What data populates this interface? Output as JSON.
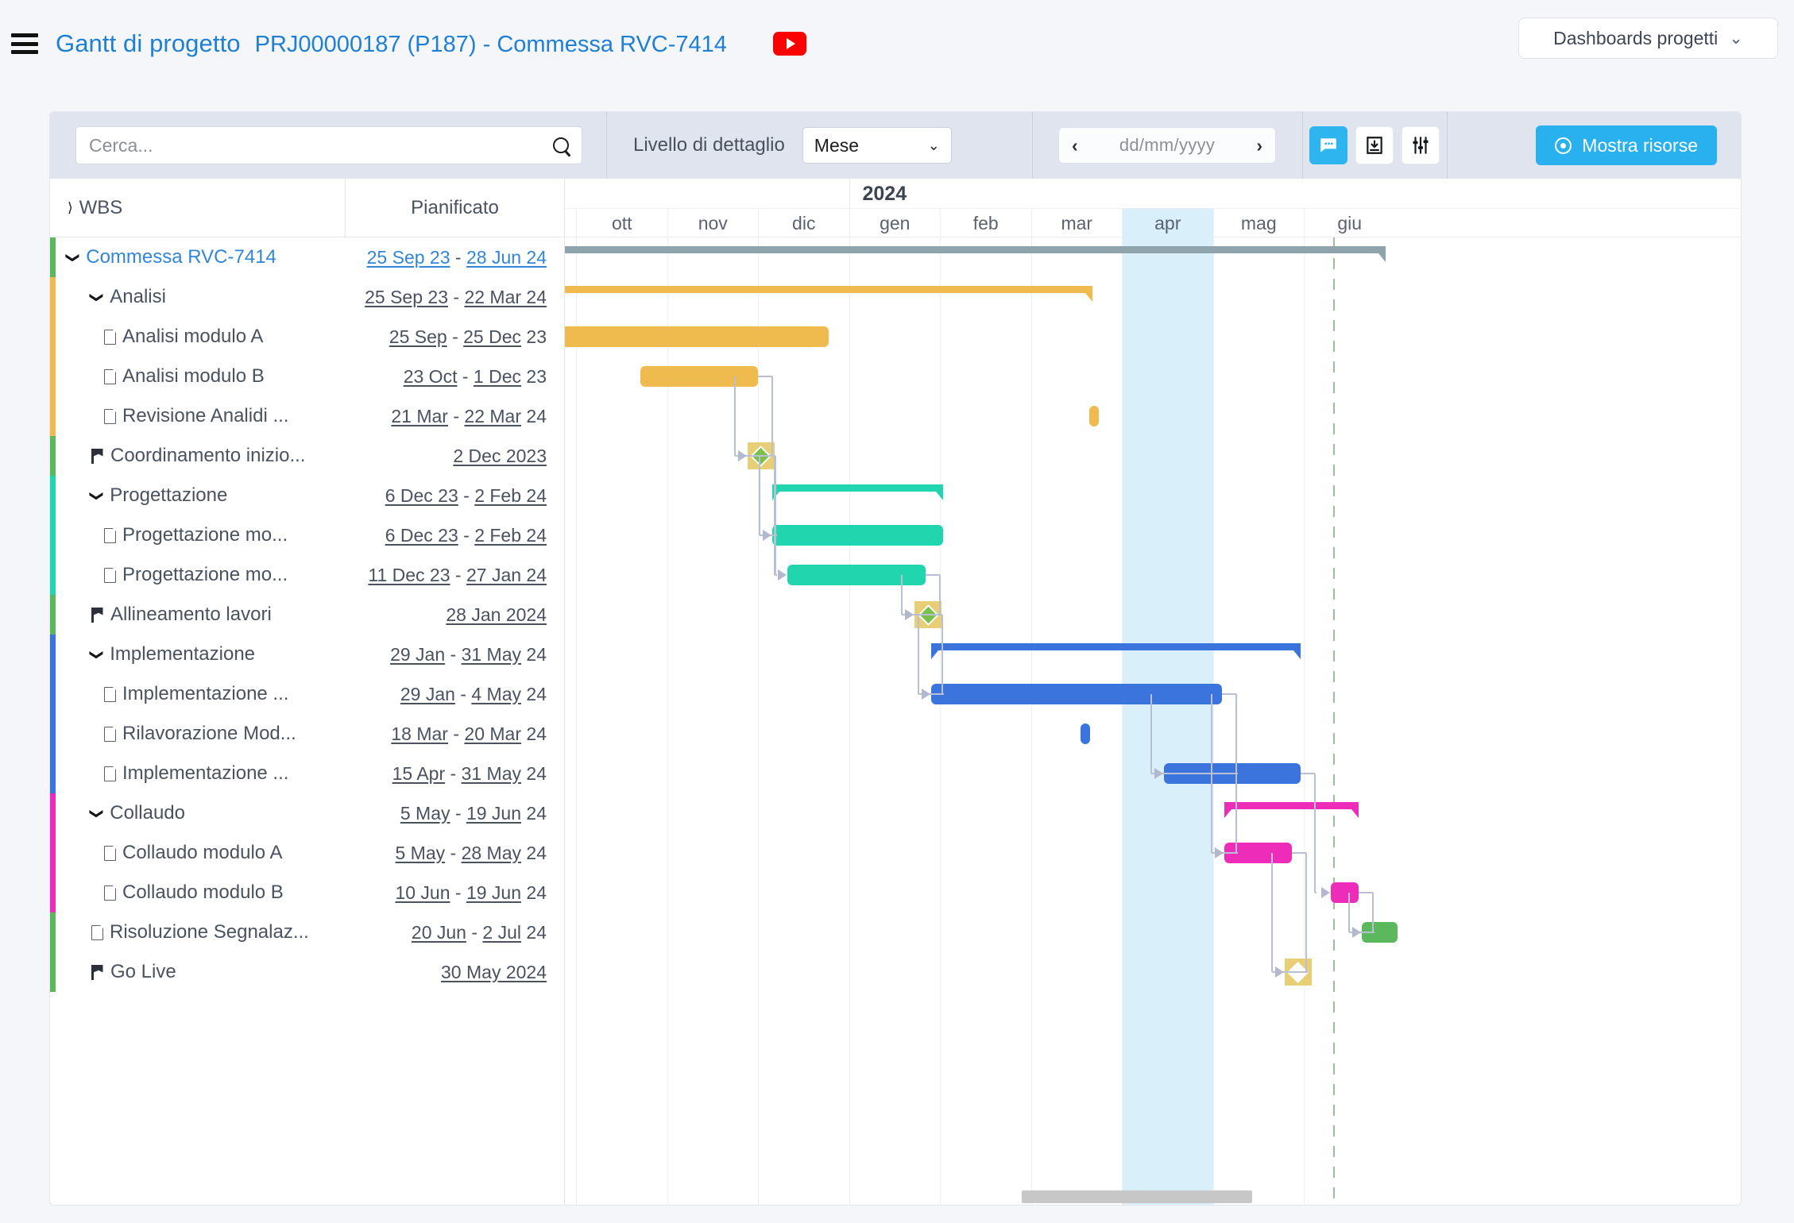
{
  "header": {
    "menu_icon": "hamburger-icon",
    "title": "Gantt di progetto",
    "subtitle": "PRJ00000187 (P187) - Commessa RVC-7414",
    "video_icon": "youtube-play-icon",
    "dashboard_select": {
      "label": "Dashboards progetti",
      "chevron": "⌄"
    }
  },
  "toolbar": {
    "search_placeholder": "Cerca...",
    "search_value": "",
    "search_icon": "search-icon",
    "detail_label": "Livello di dettaglio",
    "detail_value": "Mese",
    "detail_chevron": "⌄",
    "date_prev": "‹",
    "date_next": "›",
    "date_value": "dd/mm/yyyy",
    "icons": [
      "comment-icon",
      "export-icon",
      "settings-sliders-icon"
    ],
    "resources_button": "Mostra risorse",
    "accent_blue": "#29b1ef"
  },
  "grid": {
    "col_wbs": "WBS",
    "col_planned": "Pianificato",
    "rows": [
      {
        "name": "Commessa RVC-7414",
        "level": 0,
        "icon": "caret-down-icon",
        "kind": "root",
        "start": "25 Sep 23",
        "end": "28 Jun 24",
        "year_suffix": "",
        "stripe": "#5cb85c"
      },
      {
        "name": "Analisi",
        "level": 1,
        "icon": "caret-down-icon",
        "kind": "summary",
        "start": "25 Sep 23",
        "end": "22 Mar 24",
        "year_suffix": "",
        "stripe": "#efbb4e"
      },
      {
        "name": "Analisi modulo A",
        "level": 2,
        "icon": "doc-icon",
        "kind": "task",
        "start": "25 Sep",
        "end": "25 Dec",
        "year_suffix": " 23",
        "stripe": "#efbb4e"
      },
      {
        "name": "Analisi modulo B",
        "level": 2,
        "icon": "doc-icon",
        "kind": "task",
        "start": "23 Oct",
        "end": "1 Dec",
        "year_suffix": " 23",
        "stripe": "#efbb4e"
      },
      {
        "name": "Revisione Analidi ...",
        "level": 2,
        "icon": "doc-icon",
        "kind": "task",
        "start": "21 Mar",
        "end": "22 Mar",
        "year_suffix": " 24",
        "stripe": "#efbb4e"
      },
      {
        "name": "Coordinamento inizio...",
        "level": 1,
        "icon": "flag-icon",
        "kind": "milestone",
        "start": "",
        "end": "2 Dec 2023",
        "year_suffix": "",
        "stripe": "#5cb85c"
      },
      {
        "name": "Progettazione",
        "level": 1,
        "icon": "caret-down-icon",
        "kind": "summary",
        "start": "6 Dec 23",
        "end": "2 Feb 24",
        "year_suffix": "",
        "stripe": "#21d6ae"
      },
      {
        "name": "Progettazione mo...",
        "level": 2,
        "icon": "doc-icon",
        "kind": "task",
        "start": "6 Dec 23",
        "end": "2 Feb 24",
        "year_suffix": "",
        "stripe": "#21d6ae"
      },
      {
        "name": "Progettazione mo...",
        "level": 2,
        "icon": "doc-icon",
        "kind": "task",
        "start": "11 Dec 23",
        "end": "27 Jan 24",
        "year_suffix": "",
        "stripe": "#21d6ae"
      },
      {
        "name": "Allineamento lavori",
        "level": 1,
        "icon": "flag-icon",
        "kind": "milestone",
        "start": "",
        "end": "28 Jan 2024",
        "year_suffix": "",
        "stripe": "#5cb85c"
      },
      {
        "name": "Implementazione",
        "level": 1,
        "icon": "caret-down-icon",
        "kind": "summary",
        "start": "29 Jan",
        "end": "31 May",
        "year_suffix": " 24",
        "stripe": "#3b74dd"
      },
      {
        "name": "Implementazione ...",
        "level": 2,
        "icon": "doc-icon",
        "kind": "task",
        "start": "29 Jan",
        "end": "4 May",
        "year_suffix": " 24",
        "stripe": "#3b74dd"
      },
      {
        "name": "Rilavorazione Mod...",
        "level": 2,
        "icon": "doc-icon",
        "kind": "task",
        "start": "18 Mar",
        "end": "20 Mar",
        "year_suffix": " 24",
        "stripe": "#3b74dd"
      },
      {
        "name": "Implementazione ...",
        "level": 2,
        "icon": "doc-icon",
        "kind": "task",
        "start": "15 Apr",
        "end": "31 May",
        "year_suffix": " 24",
        "stripe": "#3b74dd"
      },
      {
        "name": "Collaudo",
        "level": 1,
        "icon": "caret-down-icon",
        "kind": "summary",
        "start": "5 May",
        "end": "19 Jun",
        "year_suffix": " 24",
        "stripe": "#ee2cba"
      },
      {
        "name": "Collaudo modulo A",
        "level": 2,
        "icon": "doc-icon",
        "kind": "task",
        "start": "5 May",
        "end": "28 May",
        "year_suffix": " 24",
        "stripe": "#ee2cba"
      },
      {
        "name": "Collaudo modulo B",
        "level": 2,
        "icon": "doc-icon",
        "kind": "task",
        "start": "10 Jun",
        "end": "19 Jun",
        "year_suffix": " 24",
        "stripe": "#ee2cba"
      },
      {
        "name": "Risoluzione Segnalaz...",
        "level": 1,
        "icon": "doc-icon",
        "kind": "task",
        "start": "20 Jun",
        "end": "2 Jul",
        "year_suffix": " 24",
        "stripe": "#5cb85c"
      },
      {
        "name": "Go Live",
        "level": 1,
        "icon": "flag-icon",
        "kind": "milestone",
        "start": "",
        "end": "30 May 2024",
        "year_suffix": "",
        "stripe": "#5cb85c"
      }
    ]
  },
  "chart_data": {
    "type": "gantt",
    "title": "Gantt di progetto PRJ00000187 (P187) - Commessa RVC-7414",
    "year_label": "2024",
    "year_label_start_month": "gen",
    "months": [
      "ott",
      "nov",
      "dic",
      "gen",
      "feb",
      "mar",
      "apr",
      "mag",
      "giu"
    ],
    "highlighted_month": "apr",
    "today_marker_month": "giu",
    "colors": {
      "root_summary": "#8fa3ad",
      "analisi": "#efbb4e",
      "progettazione": "#21d6ae",
      "implementazione": "#3b74dd",
      "collaudo": "#ee2cba",
      "risoluzione": "#5cb85c",
      "milestone_box": "#e8cf75",
      "milestone_diamond_green": "#7cc04c",
      "milestone_diamond_white": "#ffffff",
      "today_line": "#9bbf9b",
      "highlight_column": "#d9f0fb",
      "dependency_link": "#b9bfd4"
    },
    "bars": [
      {
        "row": 0,
        "label": "Commessa RVC-7414",
        "kind": "summary",
        "start": "25 Sep 23",
        "end": "28 Jun 24",
        "color": "#8fa3ad"
      },
      {
        "row": 1,
        "label": "Analisi",
        "kind": "summary",
        "start": "25 Sep 23",
        "end": "22 Mar 24",
        "color": "#efbb4e"
      },
      {
        "row": 2,
        "label": "Analisi modulo A",
        "kind": "task",
        "start": "25 Sep 23",
        "end": "25 Dec 23",
        "color": "#efbb4e"
      },
      {
        "row": 3,
        "label": "Analisi modulo B",
        "kind": "task",
        "start": "23 Oct 23",
        "end": "1 Dec 23",
        "color": "#efbb4e"
      },
      {
        "row": 4,
        "label": "Revisione Analidi",
        "kind": "task",
        "start": "21 Mar 24",
        "end": "22 Mar 24",
        "color": "#efbb4e"
      },
      {
        "row": 5,
        "label": "Coordinamento inizio",
        "kind": "milestone",
        "start": "2 Dec 2023",
        "end": "2 Dec 2023",
        "color": "#7cc04c"
      },
      {
        "row": 6,
        "label": "Progettazione",
        "kind": "summary",
        "start": "6 Dec 23",
        "end": "2 Feb 24",
        "color": "#21d6ae"
      },
      {
        "row": 7,
        "label": "Progettazione mo A",
        "kind": "task",
        "start": "6 Dec 23",
        "end": "2 Feb 24",
        "color": "#21d6ae"
      },
      {
        "row": 8,
        "label": "Progettazione mo B",
        "kind": "task",
        "start": "11 Dec 23",
        "end": "27 Jan 24",
        "color": "#21d6ae"
      },
      {
        "row": 9,
        "label": "Allineamento lavori",
        "kind": "milestone",
        "start": "28 Jan 2024",
        "end": "28 Jan 2024",
        "color": "#7cc04c"
      },
      {
        "row": 10,
        "label": "Implementazione",
        "kind": "summary",
        "start": "29 Jan 24",
        "end": "31 May 24",
        "color": "#3b74dd"
      },
      {
        "row": 11,
        "label": "Implementazione A",
        "kind": "task",
        "start": "29 Jan 24",
        "end": "4 May 24",
        "color": "#3b74dd"
      },
      {
        "row": 12,
        "label": "Rilavorazione Mod",
        "kind": "task",
        "start": "18 Mar 24",
        "end": "20 Mar 24",
        "color": "#3b74dd"
      },
      {
        "row": 13,
        "label": "Implementazione B",
        "kind": "task",
        "start": "15 Apr 24",
        "end": "31 May 24",
        "color": "#3b74dd"
      },
      {
        "row": 14,
        "label": "Collaudo",
        "kind": "summary",
        "start": "5 May 24",
        "end": "19 Jun 24",
        "color": "#ee2cba"
      },
      {
        "row": 15,
        "label": "Collaudo modulo A",
        "kind": "task",
        "start": "5 May 24",
        "end": "28 May 24",
        "color": "#ee2cba"
      },
      {
        "row": 16,
        "label": "Collaudo modulo B",
        "kind": "task",
        "start": "10 Jun 24",
        "end": "19 Jun 24",
        "color": "#ee2cba"
      },
      {
        "row": 17,
        "label": "Risoluzione Segnalaz",
        "kind": "task",
        "start": "20 Jun 24",
        "end": "2 Jul 24",
        "color": "#5cb85c"
      },
      {
        "row": 18,
        "label": "Go Live",
        "kind": "milestone",
        "start": "30 May 2024",
        "end": "30 May 2024",
        "color": "#ffffff"
      }
    ]
  }
}
